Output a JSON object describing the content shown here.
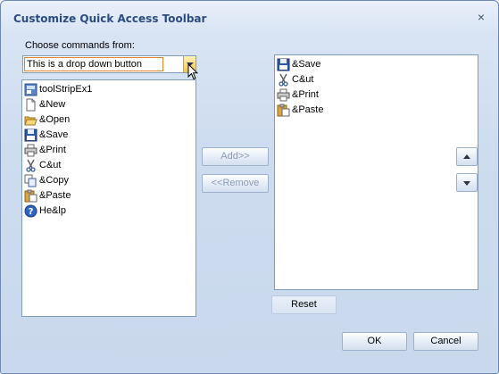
{
  "window": {
    "title": "Customize Quick Access Toolbar",
    "close_glyph": "×"
  },
  "choose": {
    "label": "Choose commands from:",
    "value": "This is a drop down button"
  },
  "available_commands": [
    {
      "label": "toolStripEx1",
      "icon": "toolstrip-icon"
    },
    {
      "label": "&New",
      "icon": "new-document-icon"
    },
    {
      "label": "&Open",
      "icon": "open-folder-icon"
    },
    {
      "label": "&Save",
      "icon": "save-disk-icon"
    },
    {
      "label": "&Print",
      "icon": "printer-icon"
    },
    {
      "label": "C&ut",
      "icon": "scissors-icon"
    },
    {
      "label": "&Copy",
      "icon": "copy-icon"
    },
    {
      "label": "&Paste",
      "icon": "paste-icon"
    },
    {
      "label": "He&lp",
      "icon": "help-icon"
    }
  ],
  "toolbar_commands": [
    {
      "label": "&Save",
      "icon": "save-disk-icon"
    },
    {
      "label": "C&ut",
      "icon": "scissors-icon"
    },
    {
      "label": "&Print",
      "icon": "printer-icon"
    },
    {
      "label": "&Paste",
      "icon": "paste-icon"
    }
  ],
  "buttons": {
    "add": "Add>>",
    "remove": "<<Remove",
    "reset": "Reset",
    "ok": "OK",
    "cancel": "Cancel"
  },
  "colors": {
    "accent": "#2c4c7f",
    "combo_highlight": "#e6842b"
  }
}
